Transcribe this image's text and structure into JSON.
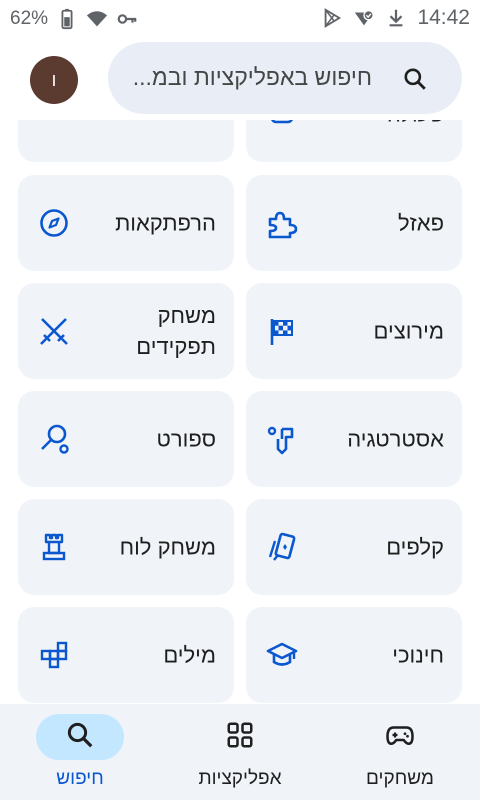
{
  "status_bar": {
    "battery_percent": "62%",
    "time": "14:42",
    "icons": [
      "battery-icon",
      "wifi-icon",
      "vpn-key-icon",
      "play-store-icon",
      "data-saver-icon",
      "download-icon"
    ]
  },
  "header": {
    "avatar_letter": "ו",
    "search_placeholder": "חיפוש באפליקציות ובמ..."
  },
  "categories": [
    {
      "label": "פעולה",
      "icon": "controller-icon"
    },
    {
      "label": "הרפתקאות",
      "icon": "compass-icon"
    },
    {
      "label": "פאזל",
      "icon": "puzzle-icon"
    },
    {
      "label": "משחק תפקידים",
      "icon": "crossed-swords-icon"
    },
    {
      "label": "מירוצים",
      "icon": "checkered-flag-icon"
    },
    {
      "label": "ספורט",
      "icon": "racket-icon"
    },
    {
      "label": "אסטרטגיה",
      "icon": "strategy-flag-icon"
    },
    {
      "label": "משחק לוח",
      "icon": "chess-rook-icon"
    },
    {
      "label": "קלפים",
      "icon": "cards-icon"
    },
    {
      "label": "מילים",
      "icon": "letter-tiles-icon"
    },
    {
      "label": "חינוכי",
      "icon": "graduation-cap-icon"
    }
  ],
  "bottom_nav": {
    "items": [
      {
        "label": "משחקים",
        "icon": "gamepad-icon",
        "active": false
      },
      {
        "label": "אפליקציות",
        "icon": "apps-grid-icon",
        "active": false
      },
      {
        "label": "חיפוש",
        "icon": "search-icon",
        "active": true
      }
    ]
  },
  "colors": {
    "accent": "#0b57d0",
    "card_background": "#f0f4f9",
    "search_background": "#e9eef6",
    "active_pill": "#c2e7ff",
    "avatar": "#5b3a30"
  }
}
